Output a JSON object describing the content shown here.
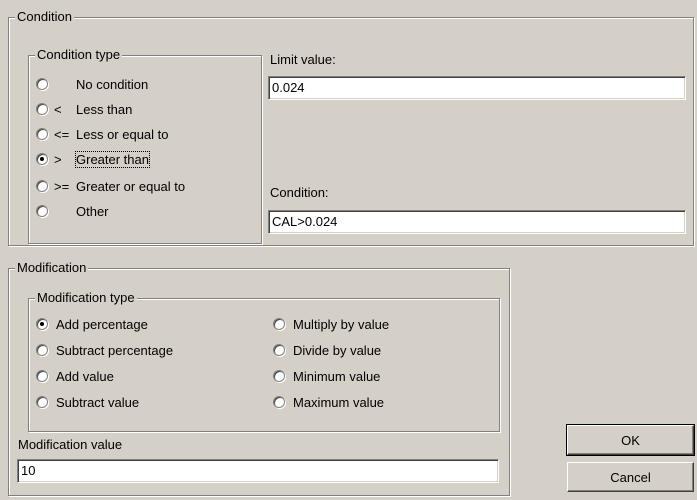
{
  "condition": {
    "title": "Condition",
    "type_group": {
      "title": "Condition type",
      "options": [
        {
          "symbol": "",
          "label": "No condition",
          "checked": false
        },
        {
          "symbol": "<",
          "label": "Less than",
          "checked": false
        },
        {
          "symbol": "<=",
          "label": "Less or equal to",
          "checked": false
        },
        {
          "symbol": ">",
          "label": "Greater than",
          "checked": true
        },
        {
          "symbol": ">=",
          "label": "Greater or equal to",
          "checked": false
        },
        {
          "symbol": "",
          "label": "Other",
          "checked": false
        }
      ]
    },
    "limit_label": "Limit value:",
    "limit_value": "0.024",
    "condition_label": "Condition:",
    "condition_value": "CAL>0.024"
  },
  "modification": {
    "title": "Modification",
    "type_group": {
      "title": "Modification type",
      "left_options": [
        {
          "label": "Add percentage",
          "checked": true
        },
        {
          "label": "Subtract percentage",
          "checked": false
        },
        {
          "label": "Add value",
          "checked": false
        },
        {
          "label": "Subtract value",
          "checked": false
        }
      ],
      "right_options": [
        {
          "label": "Multiply by value",
          "checked": false
        },
        {
          "label": "Divide by value",
          "checked": false
        },
        {
          "label": "Minimum value",
          "checked": false
        },
        {
          "label": "Maximum value",
          "checked": false
        }
      ]
    },
    "value_label": "Modification value",
    "value": "10"
  },
  "buttons": {
    "ok": "OK",
    "cancel": "Cancel"
  }
}
